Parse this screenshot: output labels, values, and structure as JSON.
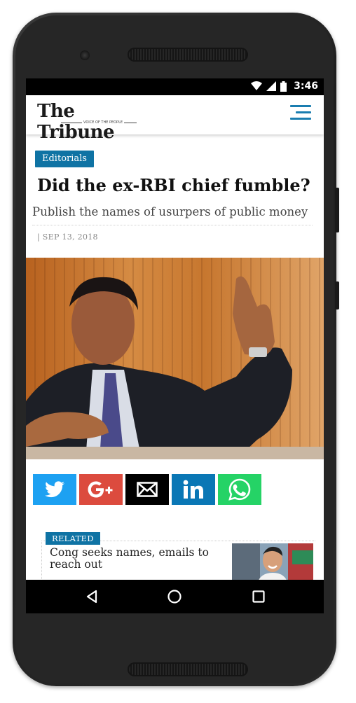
{
  "status_bar": {
    "time": "3:46",
    "icons": [
      "wifi-icon",
      "cell-signal-icon",
      "battery-icon"
    ]
  },
  "header": {
    "logo_text": "The Tribune",
    "logo_tagline": "VOICE OF THE PEOPLE",
    "menu_icon": "hamburger-menu-icon"
  },
  "article": {
    "category": "Editorials",
    "headline": "Did the ex-RBI chief fumble?",
    "subheadline": "Publish the names of usurpers of public money",
    "dateline": "| SEP 13, 2018"
  },
  "share": {
    "buttons": [
      {
        "icon": "twitter-icon",
        "color": "#1da1f2"
      },
      {
        "icon": "google-plus-icon",
        "color": "#dc4b3e"
      },
      {
        "icon": "email-icon",
        "color": "#000000"
      },
      {
        "icon": "linkedin-icon",
        "color": "#0a77b5"
      },
      {
        "icon": "whatsapp-icon",
        "color": "#25d366"
      }
    ]
  },
  "related": {
    "badge": "RELATED",
    "title": "Cong seeks names, emails to reach out"
  },
  "nav_bar": {
    "buttons": [
      "back-icon",
      "home-icon",
      "recents-icon"
    ]
  },
  "colors": {
    "accent": "#0f73a4",
    "menu": "#1a7db0",
    "text": "#111111"
  }
}
